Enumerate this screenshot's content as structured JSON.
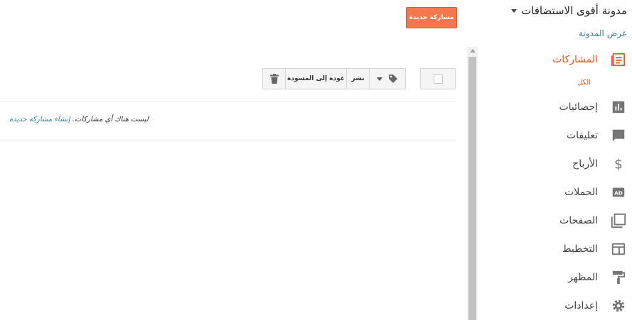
{
  "blog": {
    "title": "مدونة أقوى الاستضافات",
    "view_blog": "عرض المدونة"
  },
  "header": {
    "new_post": "مشاركة جديدة"
  },
  "toolbar": {
    "publish": "نشر",
    "revert_to_draft": "عودة إلى المسودة"
  },
  "posts": {
    "empty_message": "ليست هناك أي مشاركات.",
    "create_link": "إنشاء مشاركة جديدة"
  },
  "sidebar": {
    "accent_color": "#f4511e",
    "items": [
      {
        "label": "المشاركات",
        "icon": "posts-icon",
        "active": true
      },
      {
        "label": "إحصائيات",
        "icon": "stats-icon"
      },
      {
        "label": "تعليقات",
        "icon": "comments-icon"
      },
      {
        "label": "الأرباح",
        "icon": "earnings-dollar-icon"
      },
      {
        "label": "الحملات",
        "icon": "campaigns-ad-icon"
      },
      {
        "label": "الصفحات",
        "icon": "pages-icon"
      },
      {
        "label": "التخطيط",
        "icon": "layout-icon"
      },
      {
        "label": "المظهر",
        "icon": "theme-paint-roller-icon"
      },
      {
        "label": "إعدادات",
        "icon": "settings-gear-icon"
      }
    ],
    "sub_items": [
      {
        "label": "الكل"
      }
    ]
  }
}
